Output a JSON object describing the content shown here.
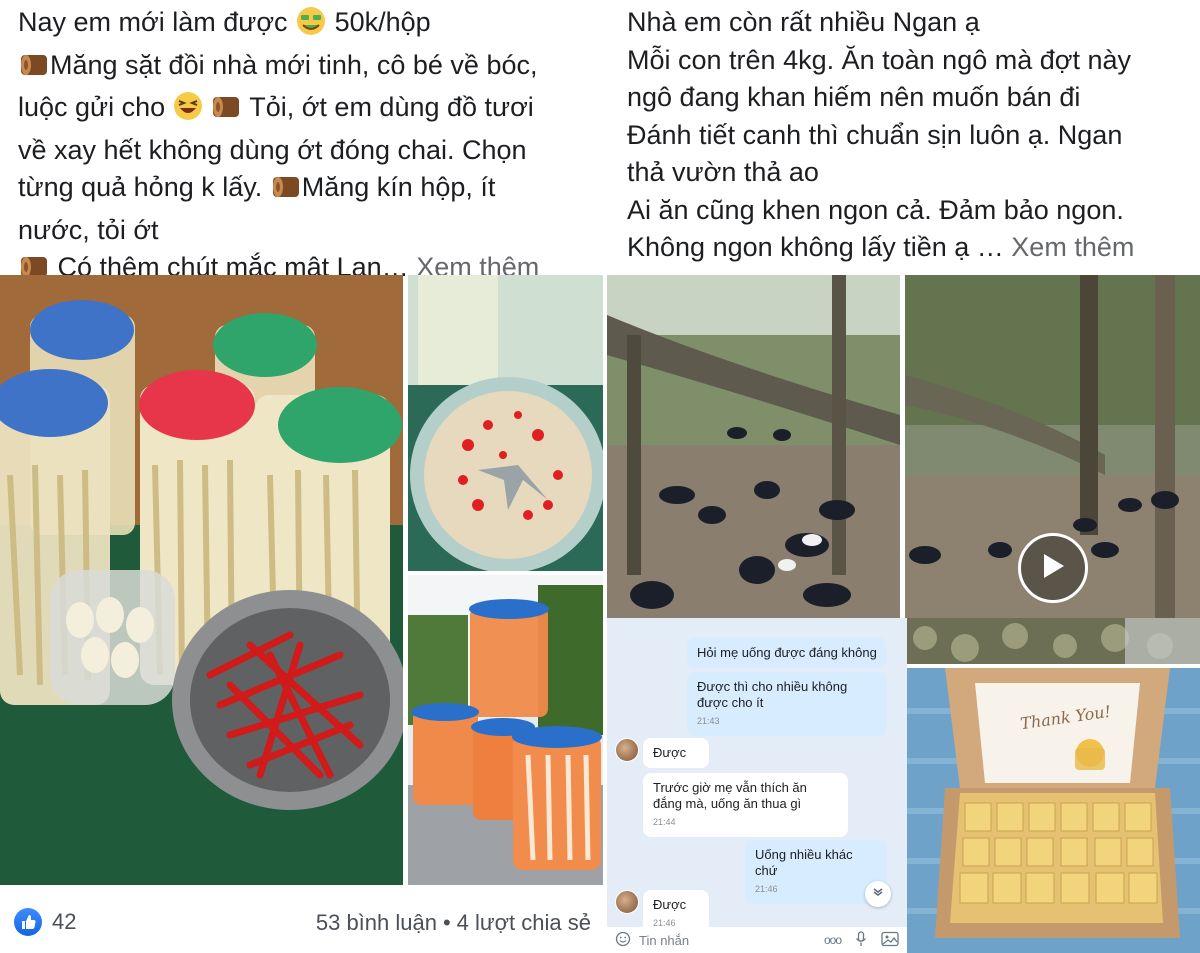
{
  "left_post": {
    "lines": [
      "Nay em mới làm được",
      "50k/hộp",
      "Măng sặt đồi nhà mới tinh, cô bé về bóc,",
      "luộc gửi cho",
      "Tỏi, ớt em dùng đồ tươi",
      "về xay hết không dùng ớt đóng chai. Chọn",
      "từng quả hỏng k lấy.",
      "Măng kín hộp, ít",
      "nước, tỏi ớt",
      "Có thêm chút mắc mật Lạn…",
      "Xem thêm"
    ],
    "reactions": {
      "count": "42",
      "icon": "like-icon"
    },
    "comments": "53 bình luận",
    "shares": "4 lượt chia sẻ",
    "separator": "•"
  },
  "right_post": {
    "lines": [
      "Nhà em còn rất nhiều Ngan ạ",
      "Mỗi con trên 4kg. Ăn toàn ngô mà đợt này",
      "ngô đang khan hiếm nên muốn bán đi",
      "Đánh tiết canh thì chuẩn sịn luôn ạ. Ngan",
      "thả vườn thả ao",
      "Ai ăn cũng khen ngon cả. Đảm bảo ngon.",
      "Không ngon không lấy tiền ạ …",
      "Xem thêm"
    ],
    "chat": {
      "messages": [
        {
          "from": "me",
          "text": "Hỏi mẹ uống được đáng không",
          "time": ""
        },
        {
          "from": "me",
          "text": "Được thì cho nhiều không được cho ít",
          "time": "21:43"
        },
        {
          "from": "them",
          "text": "Được",
          "time": ""
        },
        {
          "from": "them",
          "text": "Trước giờ mẹ vẫn thích ăn đắng mà, uống ăn thua gì",
          "time": "21:44"
        },
        {
          "from": "me",
          "text": "Uống nhiều khác chứ",
          "time": "21:46"
        },
        {
          "from": "them",
          "text": "Được",
          "time": "21:46"
        }
      ],
      "input_placeholder": "Tin nhắn",
      "more_label": "ooo"
    },
    "card_text": "Thank You!"
  },
  "colors": {
    "text": "#1c1e21",
    "muted": "#65676b",
    "like_blue": "#1877f2",
    "chat_bg": "#e4edf7",
    "bubble_me": "#d7ecff"
  }
}
